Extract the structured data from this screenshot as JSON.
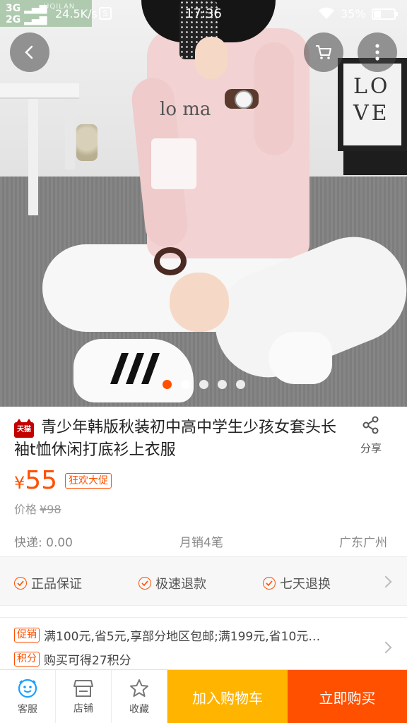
{
  "status_bar": {
    "network_1": "3G",
    "network_2": "2G",
    "speed": "24.5K/s",
    "sim_icon": "S",
    "time": "17:36",
    "battery_pct": "35%",
    "battery_level": 0.35
  },
  "gallery": {
    "image_count": 5,
    "active_index": 0,
    "poster_text": "LO VE",
    "dot_active_color": "#ff5000"
  },
  "product": {
    "store_badge": "天猫",
    "title": "青少年韩版秋装初中高中学生少孩女套头长袖t恤休闲打底衫上衣服",
    "share_label": "分享",
    "currency": "¥",
    "price": "55",
    "promo_tag": "狂欢大促",
    "original_price_label": "价格",
    "original_price": "¥98",
    "shipping": "快递: 0.00",
    "monthly_sales": "月销4笔",
    "location": "广东广州"
  },
  "guarantees": [
    {
      "label": "正品保证"
    },
    {
      "label": "极速退款"
    },
    {
      "label": "七天退换"
    }
  ],
  "promotions": [
    {
      "tag": "促销",
      "text": "满100元,省5元,享部分地区包邮;满199元,省10元…"
    },
    {
      "tag": "积分",
      "text": "购买可得27积分"
    }
  ],
  "bottom_bar": {
    "service_label": "客服",
    "store_label": "店铺",
    "favorite_label": "收藏",
    "add_cart_label": "加入购物车",
    "buy_now_label": "立即购买"
  },
  "colors": {
    "accent": "#ff5000",
    "add_cart": "#ffb400",
    "tmall_red": "#c40000"
  }
}
